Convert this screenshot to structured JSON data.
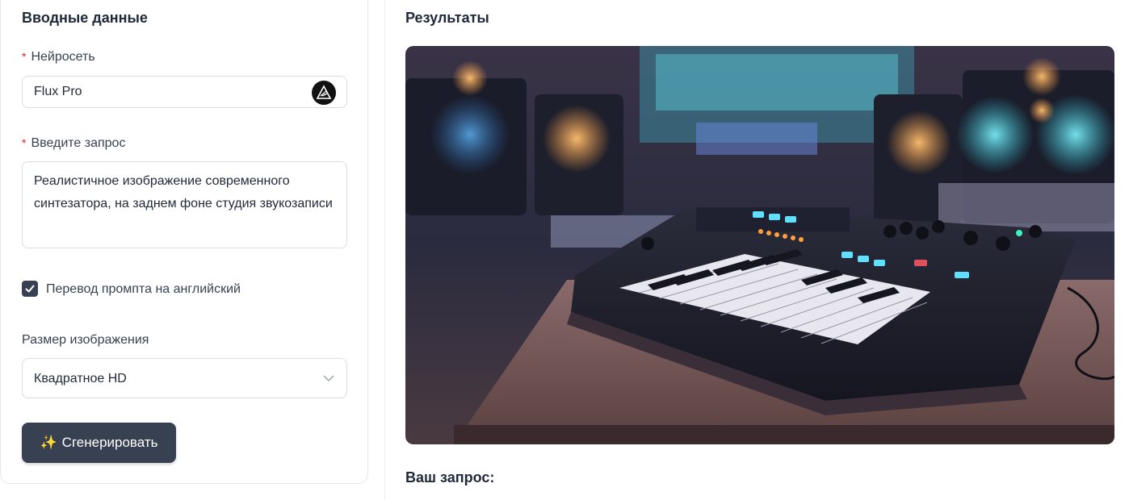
{
  "inputs": {
    "title": "Вводные данные",
    "model": {
      "label": "Нейросеть",
      "value": "Flux Pro",
      "icon": "flux-logo-icon"
    },
    "prompt": {
      "label": "Введите запрос",
      "value": "Реалистичное изображение современного синтезатора, на заднем фоне студия звукозаписи"
    },
    "translate": {
      "label": "Перевод промпта на английский",
      "checked": true
    },
    "size": {
      "label": "Размер изображения",
      "value": "Квадратное HD",
      "icon": "chevron-down-icon"
    },
    "generate": {
      "icon": "✨",
      "label": "Сгенерировать"
    }
  },
  "results": {
    "title": "Результаты",
    "image_description": "generated-synthesizer-image",
    "your_prompt_label": "Ваш запрос:"
  },
  "colors": {
    "button": "#374151",
    "required": "#dc2626",
    "border": "#d9dce1"
  }
}
